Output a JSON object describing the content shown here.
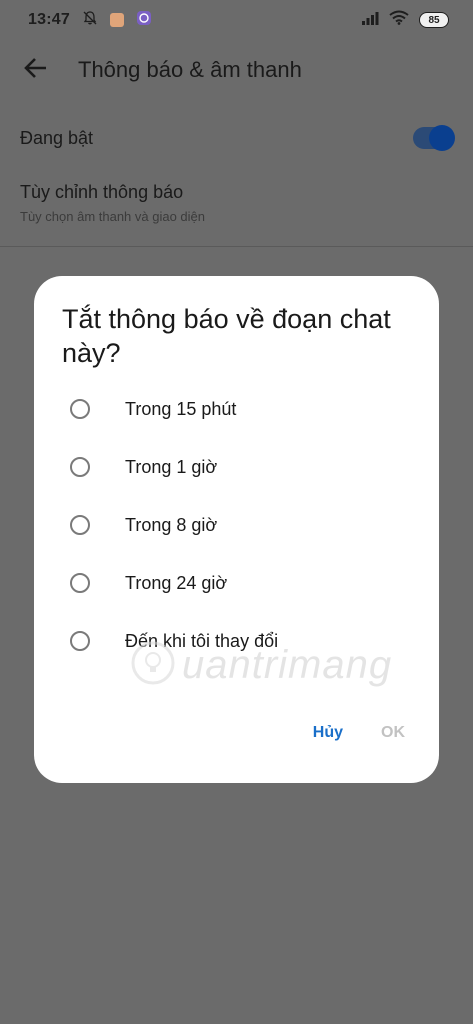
{
  "status_bar": {
    "time": "13:47",
    "battery": "85",
    "icons": [
      "bell-off-icon",
      "app-notification-icon",
      "viber-icon",
      "signal-icon",
      "wifi-icon",
      "battery-icon"
    ]
  },
  "header": {
    "title": "Thông báo & âm thanh",
    "back_icon": "arrow-left-icon"
  },
  "settings": {
    "enabled_label": "Đang bật",
    "enabled_state": true,
    "custom_title": "Tùy chỉnh thông báo",
    "custom_subtitle": "Tùy chọn âm thanh và giao diện"
  },
  "dialog": {
    "title": "Tắt thông báo về đoạn chat này?",
    "options": [
      {
        "label": "Trong 15 phút",
        "selected": false
      },
      {
        "label": "Trong 1 giờ",
        "selected": false
      },
      {
        "label": "Trong 8 giờ",
        "selected": false
      },
      {
        "label": "Trong 24 giờ",
        "selected": false
      },
      {
        "label": "Đến khi tôi thay đổi",
        "selected": false
      }
    ],
    "cancel_label": "Hủy",
    "ok_label": "OK"
  },
  "watermark": {
    "text": "uantrimang"
  },
  "colors": {
    "accent": "#1a6fc9",
    "toggle_on": "#0a3f8f",
    "dialog_bg": "#ffffff",
    "scrim": "#6b6b6b",
    "disabled": "#c2c2c2"
  }
}
